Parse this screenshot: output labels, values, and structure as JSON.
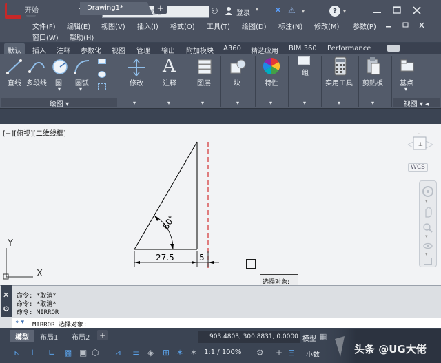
{
  "titlebar": {
    "doc_title": "Drawing1.dwg",
    "search_placeholder": "键入关键字或短语",
    "login_label": "登录"
  },
  "menubar": {
    "items": [
      "文件(F)",
      "编辑(E)",
      "视图(V)",
      "插入(I)",
      "格式(O)",
      "工具(T)",
      "绘图(D)",
      "标注(N)",
      "修改(M)",
      "参数(P)",
      "窗口(W)",
      "帮助(H)"
    ]
  },
  "ribbon_tabs": [
    "默认",
    "插入",
    "注释",
    "参数化",
    "视图",
    "管理",
    "输出",
    "附加模块",
    "A360",
    "精选应用",
    "BIM 360",
    "Performance"
  ],
  "ribbon": {
    "line": "直线",
    "polyline": "多段线",
    "circle": "圆",
    "arc": "圆弧",
    "draw_panel": "绘图",
    "modify": "修改",
    "annotation": "注释",
    "layers": "图层",
    "block": "块",
    "properties": "特性",
    "group": "组",
    "utilities": "实用工具",
    "clipboard": "剪贴板",
    "base": "基点",
    "view_panel": "视图"
  },
  "doc_tabs": {
    "start": "开始",
    "drawing": "Drawing1*"
  },
  "canvas": {
    "viewport_label": "[−][俯视][二维线框]",
    "dim_horizontal": "27.5",
    "dim_offset": "5",
    "dim_angle": "60°",
    "axis_y": "Y",
    "axis_x": "X",
    "wcs": "WCS",
    "tooltip": "选择对象:"
  },
  "command": {
    "lines": [
      "命令: *取消*",
      "命令: *取消*",
      "命令:  MIRROR"
    ],
    "prompt": "MIRROR 选择对象:"
  },
  "layout_tabs": {
    "model": "模型",
    "layout1": "布局1",
    "layout2": "布局2"
  },
  "status": {
    "coords": "903.4803, 300.8831, 0.0000",
    "model": "模型",
    "scale": "1:1 / 100%",
    "units": "小数"
  },
  "watermark": "头条 @UG大佬"
}
